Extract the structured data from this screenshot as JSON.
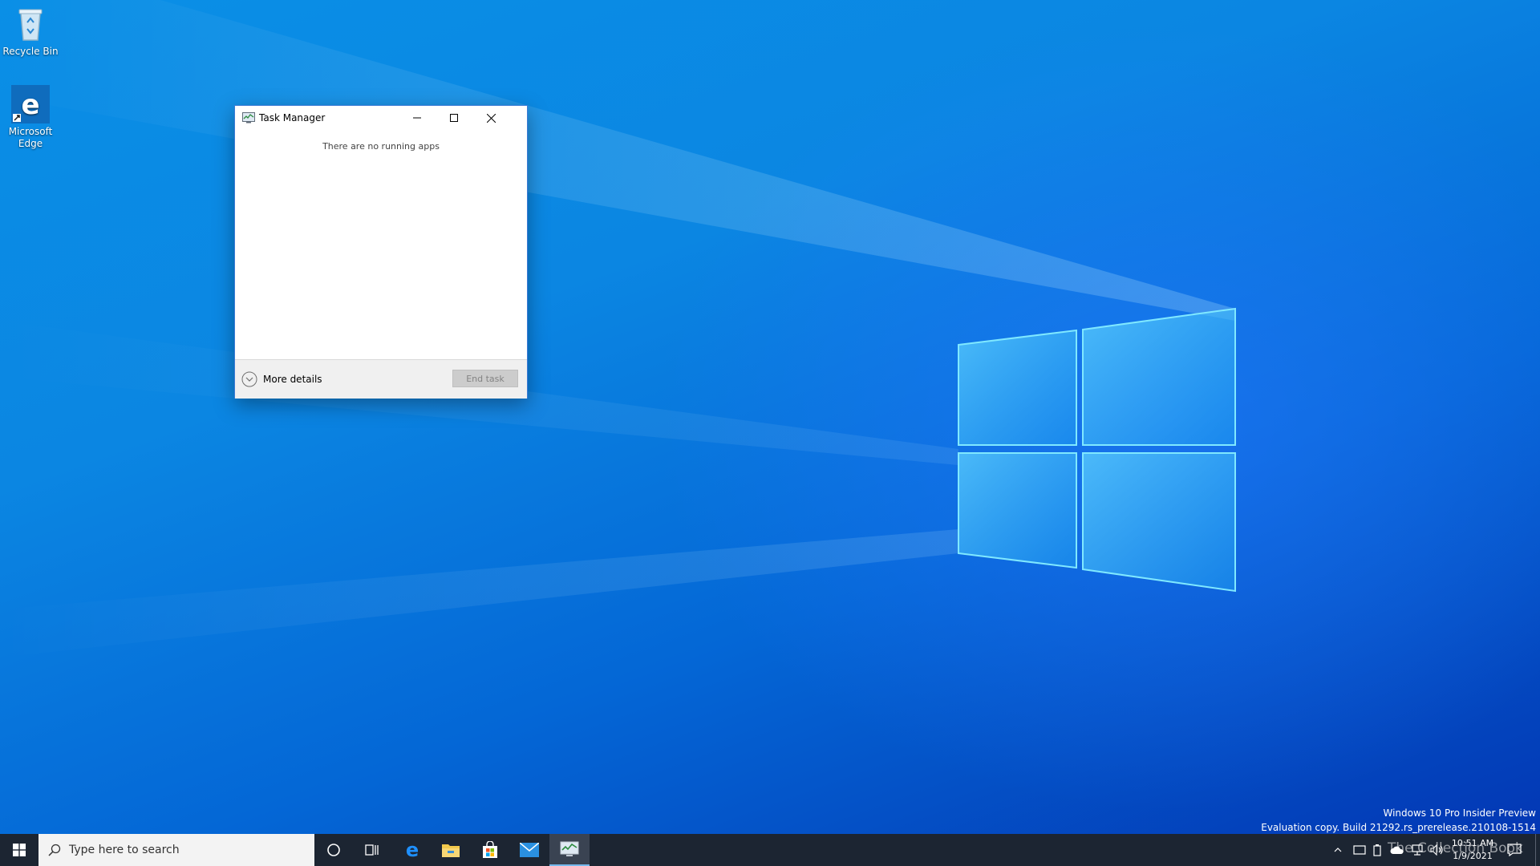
{
  "desktop": {
    "icons": [
      {
        "label": "Recycle Bin",
        "icon": "recycle-bin-icon"
      },
      {
        "label": "Microsoft Edge",
        "icon": "edge-icon"
      }
    ]
  },
  "task_manager": {
    "title": "Task Manager",
    "empty_message": "There are no running apps",
    "more_details": "More details",
    "end_task": "End task"
  },
  "watermark": {
    "line1": "Windows 10 Pro Insider Preview",
    "line2": "Evaluation copy. Build 21292.rs_prerelease.210108-1514"
  },
  "taskbar": {
    "search_placeholder": "Type here to search",
    "apps": [
      "cortana-icon",
      "task-view-icon",
      "edge-icon",
      "file-explorer-icon",
      "store-icon",
      "mail-icon",
      "task-manager-icon"
    ],
    "clock_time": "10:51 AM",
    "clock_date": "1/9/2021",
    "overlay_text": "The Collection Book"
  },
  "colors": {
    "taskbar": "#1c2532",
    "accent": "#0078d7",
    "window_border": "#3b7bd5"
  }
}
